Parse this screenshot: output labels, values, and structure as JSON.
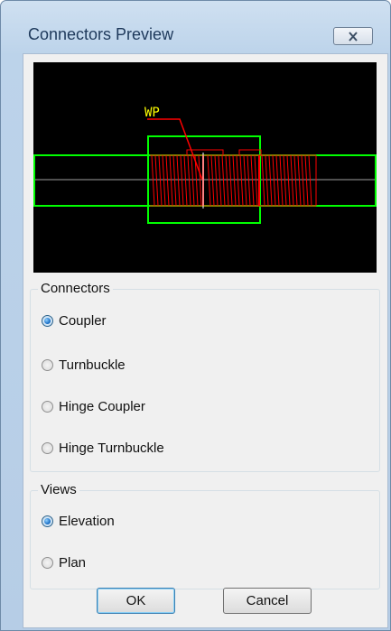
{
  "window": {
    "title": "Connectors Preview"
  },
  "preview": {
    "label": "WP"
  },
  "connectors_group": {
    "label": "Connectors",
    "options": [
      "Coupler",
      "Turnbuckle",
      "Hinge Coupler",
      "Hinge Turnbuckle"
    ],
    "selected": "Coupler"
  },
  "views_group": {
    "label": "Views",
    "options": [
      "Elevation",
      "Plan"
    ],
    "selected": "Elevation"
  },
  "buttons": {
    "ok": "OK",
    "cancel": "Cancel"
  },
  "colors": {
    "preview_bg": "#000000",
    "outline": "#00ff00",
    "thread": "#ff0000",
    "label": "#ffff00",
    "bar_line": "#a0a0a0"
  }
}
